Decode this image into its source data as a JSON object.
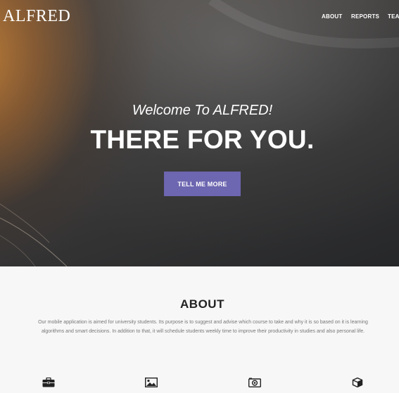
{
  "header": {
    "brand": "ALFRED",
    "nav": [
      "ABOUT",
      "REPORTS",
      "TEA"
    ]
  },
  "hero": {
    "welcome": "Welcome To ALFRED!",
    "headline": "THERE FOR YOU.",
    "cta_label": "TELL ME MORE"
  },
  "about": {
    "title": "ABOUT",
    "body": "Our mobile application is aimed for university students. Its purpose is to suggest and advise which course to take and why it is so based on it is learning algorithms and smart decisions. In addition to that, it will schedule students weekly time to improve their productivity in studies and also personal life."
  },
  "features": {
    "icons": [
      "briefcase-icon",
      "image-icon",
      "camera-icon",
      "cube-icon"
    ]
  },
  "colors": {
    "accent": "#6d66b0",
    "hero_dark": "#262729",
    "hero_warm": "#c48036",
    "section_bg": "#f7f7f7"
  }
}
